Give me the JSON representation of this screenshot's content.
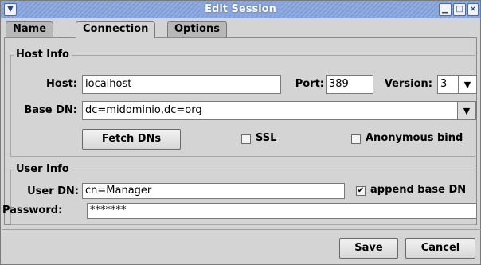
{
  "window": {
    "title": "Edit Session"
  },
  "tabs": [
    {
      "label": "Name"
    },
    {
      "label": "Connection"
    },
    {
      "label": "Options"
    }
  ],
  "host_info": {
    "title": "Host Info",
    "host_label": "Host:",
    "host_value": "localhost",
    "port_label": "Port:",
    "port_value": "389",
    "version_label": "Version:",
    "version_value": "3",
    "base_dn_label": "Base DN:",
    "base_dn_value": "dc=midominio,dc=org",
    "fetch_dns_label": "Fetch DNs",
    "ssl_label": "SSL",
    "ssl_checked": false,
    "anonymous_label": "Anonymous bind",
    "anonymous_checked": false
  },
  "user_info": {
    "title": "User Info",
    "user_dn_label": "User DN:",
    "user_dn_value": "cn=Manager",
    "append_label": "append base DN",
    "append_checked": true,
    "password_label": "Password:",
    "password_value": "*******"
  },
  "footer": {
    "save_label": "Save",
    "cancel_label": "Cancel"
  },
  "icons": {
    "menu": "chevron-down-icon",
    "minimize": "minimize-icon",
    "maximize": "maximize-icon",
    "close": "close-icon",
    "combo": "chevron-down-icon",
    "check": "checkmark-icon"
  },
  "colors": {
    "titlebar": "#8aa6dc",
    "window_bg": "#d4d4d4"
  }
}
